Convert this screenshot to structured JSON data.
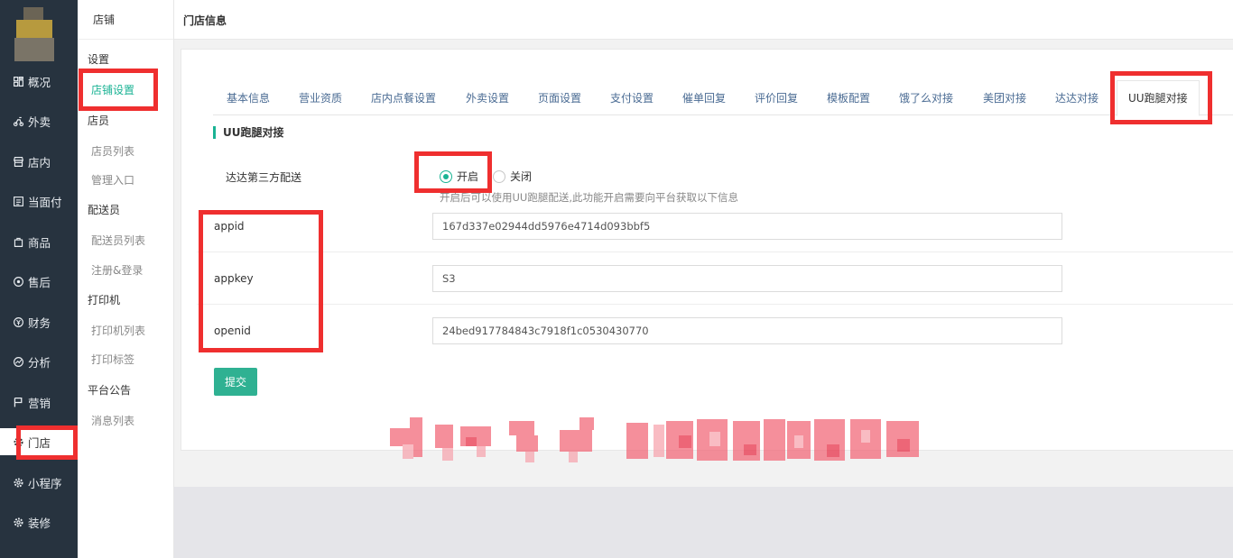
{
  "nav": {
    "items": [
      {
        "label": "概况",
        "icon": "overview-icon"
      },
      {
        "label": "外卖",
        "icon": "delivery-icon"
      },
      {
        "label": "店内",
        "icon": "store-icon"
      },
      {
        "label": "当面付",
        "icon": "pay-icon"
      },
      {
        "label": "商品",
        "icon": "goods-icon"
      },
      {
        "label": "售后",
        "icon": "aftersale-icon"
      },
      {
        "label": "财务",
        "icon": "finance-icon"
      },
      {
        "label": "分析",
        "icon": "analysis-icon"
      },
      {
        "label": "营销",
        "icon": "flag-icon"
      },
      {
        "label": "门店",
        "icon": "gear-icon"
      },
      {
        "label": "小程序",
        "icon": "gear-icon"
      },
      {
        "label": "装修",
        "icon": "gear-icon"
      }
    ],
    "active": "门店"
  },
  "sub": {
    "title": "店铺",
    "groups": {
      "settings": "设置",
      "staff": "店员",
      "courier": "配送员",
      "printer": "打印机",
      "notice": "平台公告"
    },
    "links": {
      "store_settings": "店铺设置",
      "staff_list": "店员列表",
      "admin_entry": "管理入口",
      "courier_list": "配送员列表",
      "register_login": "注册&登录",
      "printer_list": "打印机列表",
      "print_label": "打印标签",
      "message_list": "消息列表"
    }
  },
  "header": {
    "title": "门店信息"
  },
  "tabs": [
    "基本信息",
    "营业资质",
    "店内点餐设置",
    "外卖设置",
    "页面设置",
    "支付设置",
    "催单回复",
    "评价回复",
    "模板配置",
    "饿了么对接",
    "美团对接",
    "达达对接",
    "UU跑腿对接"
  ],
  "active_tab": "UU跑腿对接",
  "section": {
    "title": "UU跑腿对接"
  },
  "form": {
    "delivery_label": "达达第三方配送",
    "radio_on": "开启",
    "radio_off": "关闭",
    "selected": "开启",
    "hint": "开启后可以使用UU跑腿配送,此功能开启需要向平台获取以下信息",
    "appid_label": "appid",
    "appid_value": "167d337e02944dd5976e4714d093bbf5",
    "appkey_label": "appkey",
    "appkey_value": "S3",
    "openid_label": "openid",
    "openid_value": "24bed917784843c7918f1c0530430770",
    "submit": "提交"
  },
  "colors": {
    "nav_bg": "#27333f",
    "accent": "#1ab394",
    "button": "#2fb192",
    "highlight": "#ef2f2f"
  }
}
